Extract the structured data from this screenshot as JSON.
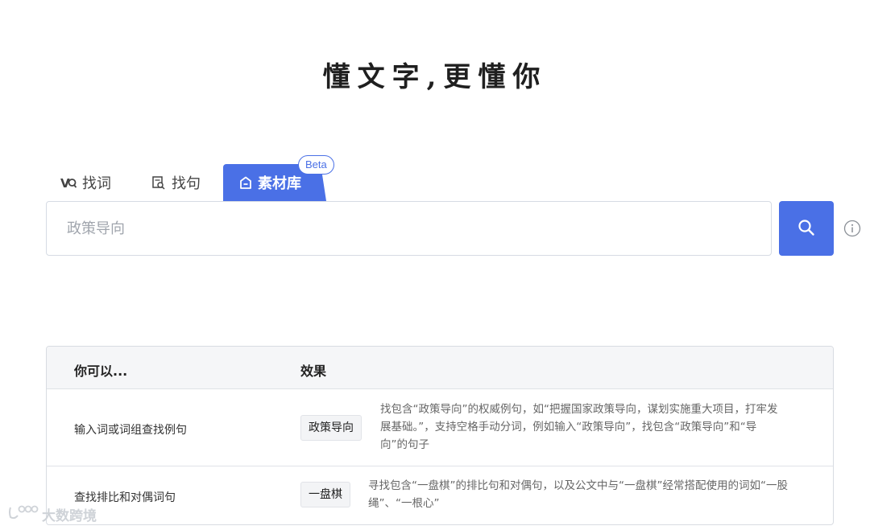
{
  "slogan": "懂文字,更懂你",
  "tabs": [
    {
      "label": "找词",
      "icon": "word-search-icon",
      "active": false
    },
    {
      "label": "找句",
      "icon": "sentence-search-icon",
      "active": false
    },
    {
      "label": "素材库",
      "icon": "material-library-icon",
      "active": true
    }
  ],
  "beta_label": "Beta",
  "search": {
    "placeholder": "政策导向",
    "value": "",
    "button_icon": "search-icon",
    "info_icon": "info-icon"
  },
  "colors": {
    "accent": "#4a70e6",
    "border": "#d6dbe4",
    "header_bg": "#f5f6f8"
  },
  "tips": {
    "headers": [
      "你可以...",
      "效果"
    ],
    "rows": [
      {
        "what": "输入词或词组查找例句",
        "sample": "政策导向",
        "effect": "找包含“政策导向”的权威例句，如“把握国家政策导向，谋划实施重大项目，打牢发展基础。”，支持空格手动分词，例如输入“政策导向”，找包含“政策导向”和“导向”的句子"
      },
      {
        "what": "查找排比和对偶词句",
        "sample": "一盘棋",
        "effect": "寻找包含“一盘棋”的排比句和对偶句，以及公文中与“一盘棋”经常搭配使用的词如“一股绳”、“一根心”"
      }
    ]
  },
  "watermark": "大数跨境"
}
